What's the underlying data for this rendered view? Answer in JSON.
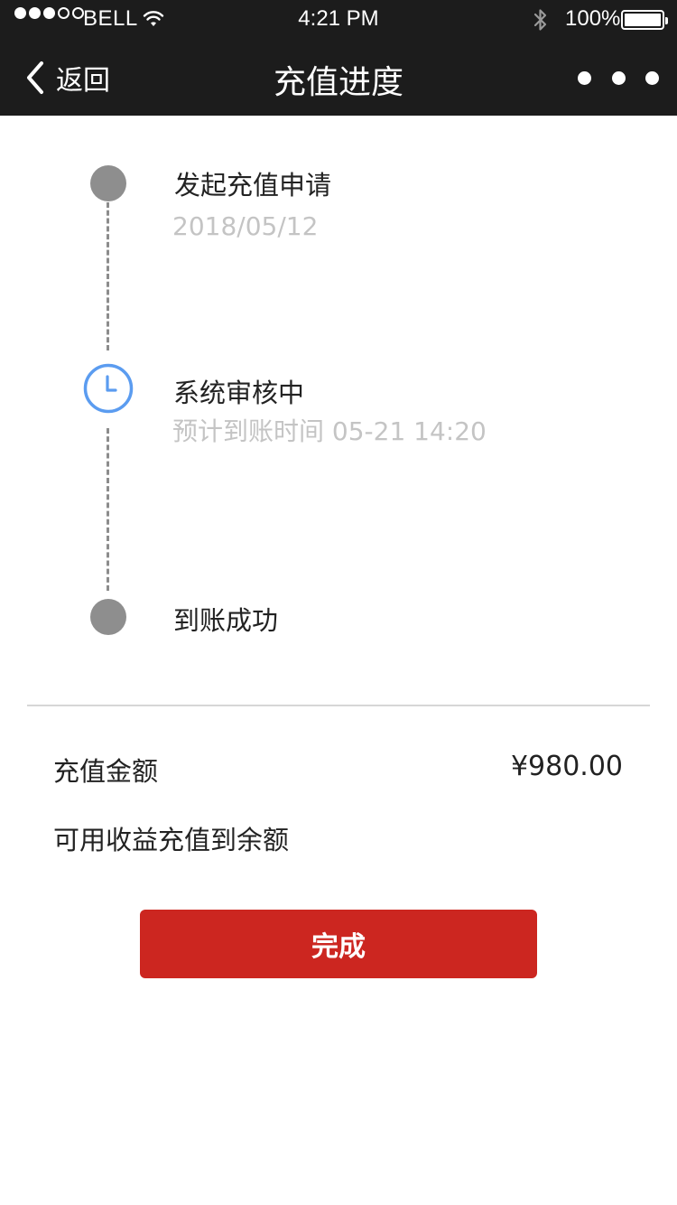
{
  "status_bar": {
    "carrier": "BELL",
    "time": "4:21 PM",
    "battery": "100%"
  },
  "nav": {
    "back_label": "返回",
    "title": "充值进度"
  },
  "steps": [
    {
      "title": "发起充值申请",
      "subtitle": "2018/05/12",
      "state": "done"
    },
    {
      "title": "系统审核中",
      "subtitle": "预计到账时间 05-21 14:20",
      "state": "in-progress"
    },
    {
      "title": "到账成功",
      "subtitle": "",
      "state": "pending"
    }
  ],
  "summary": {
    "amount_label": "充值金额",
    "amount_value": "¥980.00",
    "note": "可用收益充值到余额"
  },
  "actions": {
    "done_label": "完成"
  },
  "colors": {
    "nav_bg": "#1c1c1c",
    "accent_red": "#cc2620",
    "progress_blue": "#5b9cf0",
    "node_gray": "#8e8e8e",
    "subtitle_gray": "#c4c4c4"
  },
  "icons": {
    "back": "chevron-left-icon",
    "more": "more-horizontal-icon",
    "in_progress": "clock-icon",
    "wifi": "wifi-icon",
    "bluetooth": "bluetooth-icon",
    "battery": "battery-icon"
  }
}
